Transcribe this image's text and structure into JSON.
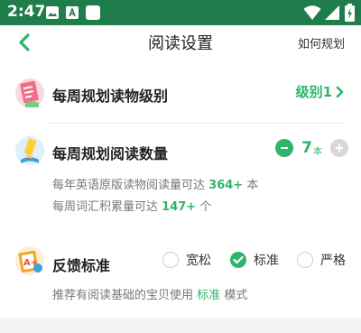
{
  "status_bar": {
    "time": "2:47",
    "icons": [
      "image-icon",
      "a-box-icon",
      "white-square-icon",
      "wifi-icon",
      "signal-icon",
      "battery-charging-icon"
    ]
  },
  "header": {
    "title": "阅读设置",
    "right_link": "如何规划"
  },
  "level_section": {
    "label": "每周规划读物级别",
    "value": "级别1"
  },
  "quantity_section": {
    "label": "每周规划阅读数量",
    "value": "7",
    "unit": "本",
    "info_1": {
      "prefix": "每年英语原版读物阅读量可达",
      "highlight": "364+",
      "suffix": "本"
    },
    "info_2": {
      "prefix": "每周词汇积累量可达",
      "highlight": "147+",
      "suffix": "个"
    }
  },
  "feedback_section": {
    "label": "反馈标准",
    "options": [
      "宽松",
      "标准",
      "严格"
    ],
    "selected": "标准",
    "hint": {
      "prefix": "推荐有阅读基础的宝贝使用",
      "highlight": "标准",
      "suffix": "模式"
    }
  },
  "colors": {
    "status_bar": "#1e7d4a",
    "accent": "#2eb56a",
    "text": "#222222",
    "muted": "#777777"
  }
}
